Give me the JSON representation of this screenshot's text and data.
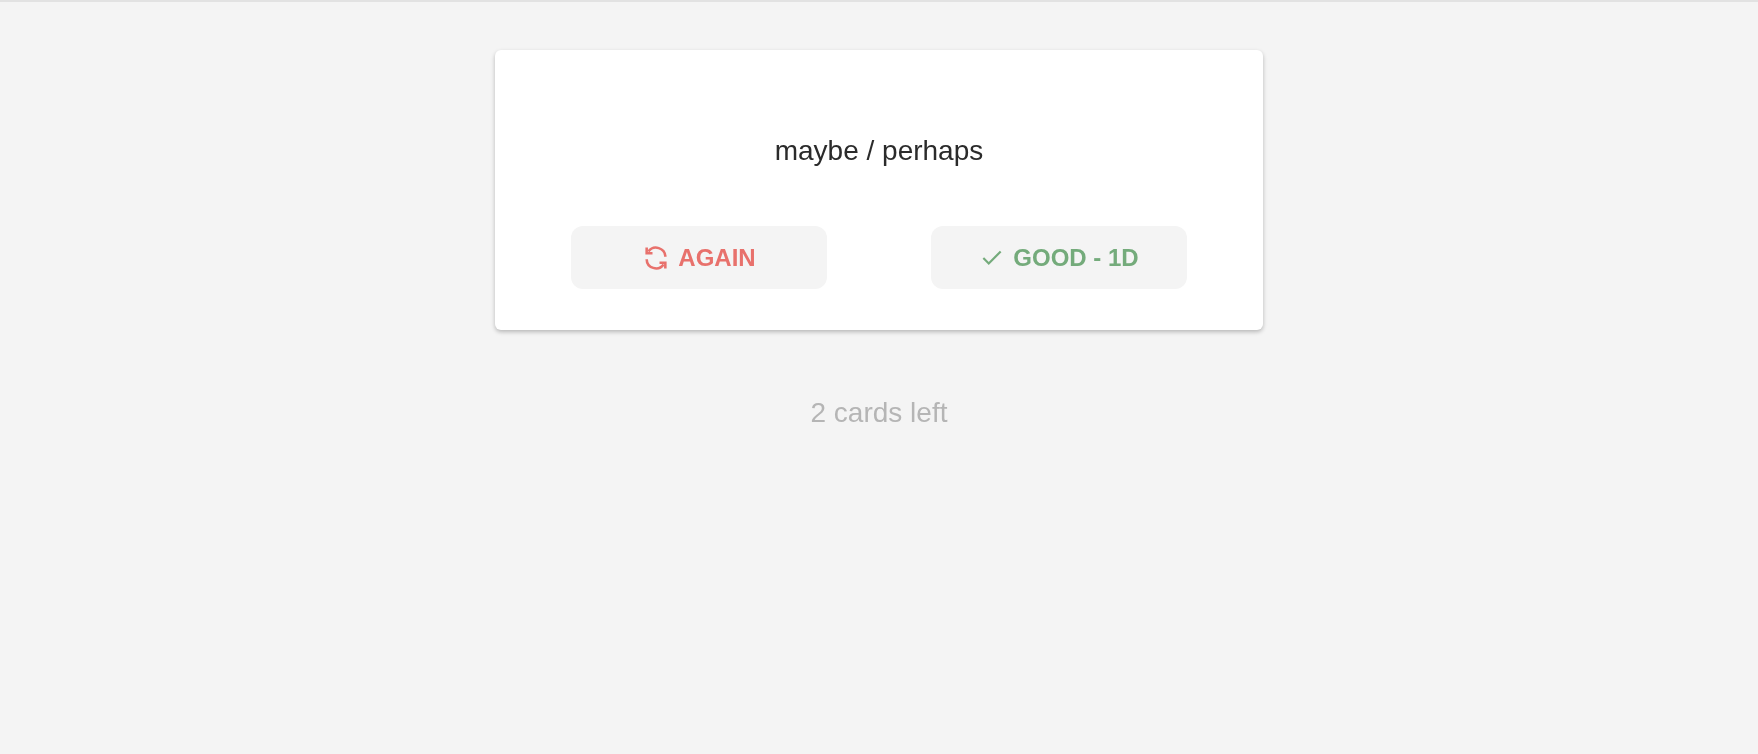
{
  "card": {
    "prompt": "maybe / perhaps"
  },
  "buttons": [
    {
      "kind": "again",
      "label": "AGAIN"
    },
    {
      "kind": "good",
      "label": "GOOD - 1D"
    }
  ],
  "remaining": "2 cards left"
}
